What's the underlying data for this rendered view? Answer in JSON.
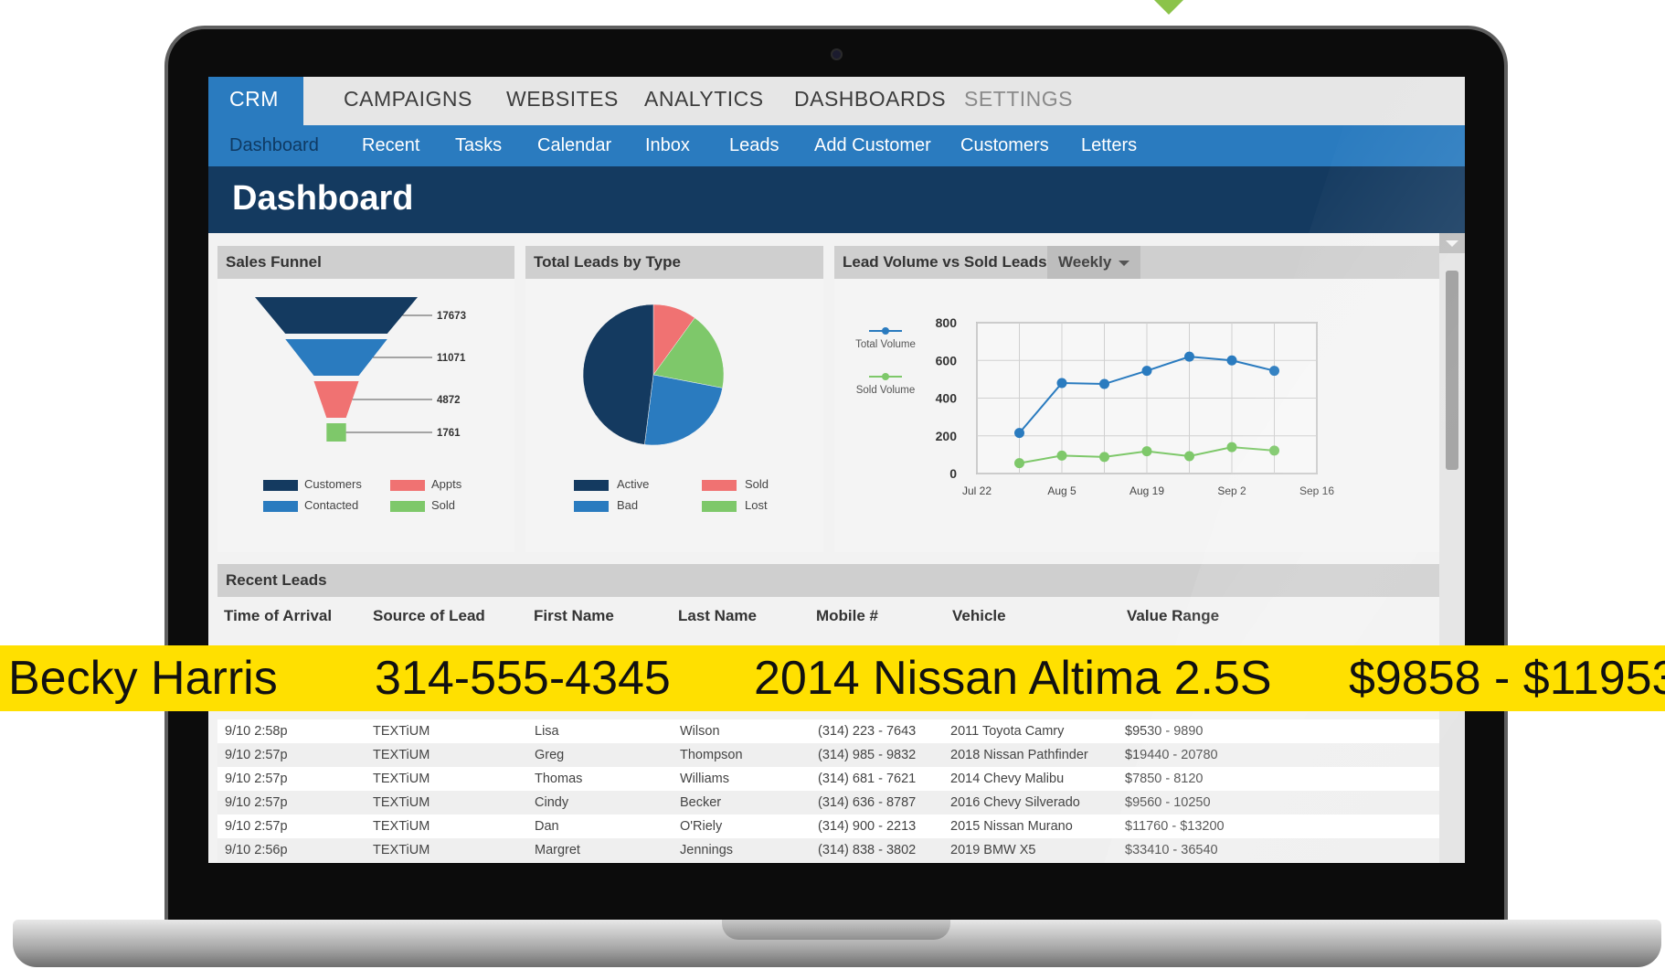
{
  "top_nav": {
    "tabs": [
      {
        "label": "CRM",
        "active": true
      },
      {
        "label": "CAMPAIGNS"
      },
      {
        "label": "WEBSITES"
      },
      {
        "label": "ANALYTICS"
      },
      {
        "label": "DASHBOARDS"
      },
      {
        "label": "SETTINGS",
        "dim": true
      }
    ]
  },
  "sub_nav": {
    "items": [
      {
        "label": "Dashboard",
        "active": true
      },
      {
        "label": "Recent"
      },
      {
        "label": "Tasks"
      },
      {
        "label": "Calendar"
      },
      {
        "label": "Inbox"
      },
      {
        "label": "Leads"
      },
      {
        "label": "Add Customer"
      },
      {
        "label": "Customers"
      },
      {
        "label": "Letters"
      }
    ]
  },
  "page_title": "Dashboard",
  "panels": {
    "sales_funnel": {
      "title": "Sales Funnel"
    },
    "leads_by_type": {
      "title": "Total Leads by Type"
    },
    "lead_volume": {
      "title": "Lead Volume vs Sold Leads",
      "period": "Weekly"
    }
  },
  "chart_data": [
    {
      "type": "funnel",
      "title": "Sales Funnel",
      "categories": [
        "Customers",
        "Contacted",
        "Appts",
        "Sold"
      ],
      "values": [
        17673,
        11071,
        4872,
        1761
      ],
      "colors": [
        "#143a60",
        "#2a7bbf",
        "#f07272",
        "#7ec86a"
      ],
      "legend": "bottom"
    },
    {
      "type": "pie",
      "title": "Total Leads by Type",
      "categories": [
        "Active",
        "Bad",
        "Sold",
        "Lost"
      ],
      "values": [
        48,
        24,
        10,
        18
      ],
      "colors": [
        "#143a60",
        "#2a7bbf",
        "#f07272",
        "#7ec86a"
      ],
      "legend": "bottom"
    },
    {
      "type": "line",
      "title": "Lead Volume vs Sold Leads",
      "x": [
        "Jul 29",
        "Aug 5",
        "Aug 12",
        "Aug 19",
        "Aug 26",
        "Sep 2",
        "Sep 9"
      ],
      "x_ticks": [
        "Jul 22",
        "Aug 5",
        "Aug 19",
        "Sep 2",
        "Sep 16"
      ],
      "xlim": [
        "Jul 22",
        "Sep 16"
      ],
      "ylim": [
        0,
        800
      ],
      "y_ticks": [
        0,
        200,
        400,
        600,
        800
      ],
      "grid": true,
      "legend": "left",
      "series": [
        {
          "name": "Total Volume",
          "color": "#2a7bbf",
          "values": [
            215,
            480,
            475,
            545,
            620,
            600,
            545
          ]
        },
        {
          "name": "Sold Volume",
          "color": "#7ec86a",
          "values": [
            55,
            95,
            88,
            118,
            92,
            140,
            122
          ]
        }
      ]
    }
  ],
  "recent_leads": {
    "title": "Recent Leads",
    "columns": [
      "Time of Arrival",
      "Source of Lead",
      "First Name",
      "Last Name",
      "Mobile #",
      "Vehicle",
      "Value Range"
    ],
    "rows": [
      [
        "9/10 2:58p",
        "TEXTiUM",
        "Lisa",
        "Wilson",
        "(314) 223 - 7643",
        "2011 Toyota Camry",
        "$9530 - 9890"
      ],
      [
        "9/10 2:57p",
        "TEXTiUM",
        "Greg",
        "Thompson",
        "(314) 985 - 9832",
        "2018 Nissan Pathfinder",
        "$19440 - 20780"
      ],
      [
        "9/10 2:57p",
        "TEXTiUM",
        "Thomas",
        "Williams",
        "(314) 681 - 7621",
        "2014 Chevy Malibu",
        "$7850 - 8120"
      ],
      [
        "9/10 2:57p",
        "TEXTiUM",
        "Cindy",
        "Becker",
        "(314) 636 - 8787",
        "2016 Chevy Silverado",
        "$9560 - 10250"
      ],
      [
        "9/10 2:57p",
        "TEXTiUM",
        "Dan",
        "O'Riely",
        "(314) 900 - 2213",
        "2015 Nissan Murano",
        "$11760 - $13200"
      ],
      [
        "9/10 2:56p",
        "TEXTiUM",
        "Margret",
        "Jennings",
        "(314) 838 - 3802",
        "2019 BMW X5",
        "$33410 - 36540"
      ]
    ]
  },
  "highlight": {
    "name": "Becky Harris",
    "phone": "314-555-4345",
    "vehicle": "2014 Nissan Altima 2.5S",
    "value": "$9858 - $11953"
  }
}
